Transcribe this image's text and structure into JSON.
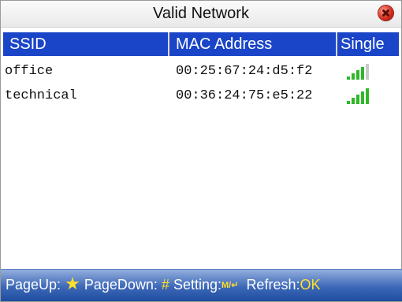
{
  "window": {
    "title": "Valid Network"
  },
  "table": {
    "headers": {
      "ssid": "SSID",
      "mac": "MAC Address",
      "signal": "Single"
    },
    "rows": [
      {
        "ssid": "office",
        "mac": "00:25:67:24:d5:f2",
        "signal_bars": 4,
        "signal_max": 5
      },
      {
        "ssid": "technical",
        "mac": "00:36:24:75:e5:22",
        "signal_bars": 5,
        "signal_max": 5
      }
    ]
  },
  "footer": {
    "pageup_label": "PageUp:",
    "pageup_key": "★",
    "pagedown_label": "PageDown:",
    "pagedown_key": "#",
    "setting_label": "Setting:",
    "setting_key": "M/↵",
    "refresh_label": "Refresh:",
    "refresh_key": "OK"
  },
  "colors": {
    "header_bg": "#1a45c8",
    "signal_on": "#2fb72a",
    "signal_off": "#c9c9c9",
    "footer_key": "#ffdf2b"
  },
  "icons": {
    "close": "close-icon",
    "signal": "signal-strength-icon"
  }
}
